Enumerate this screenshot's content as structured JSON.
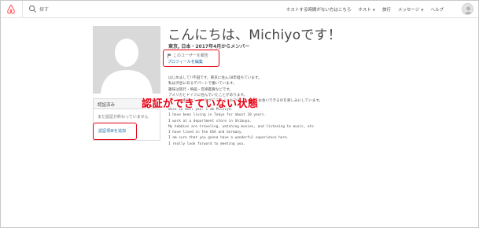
{
  "navbar": {
    "search_placeholder": "探す",
    "links": [
      {
        "label": "ホストする時間がない方はこちら",
        "caret": false
      },
      {
        "label": "ホスト",
        "caret": true
      },
      {
        "label": "旅行",
        "caret": false
      },
      {
        "label": "メッセージ",
        "caret": true
      },
      {
        "label": "ヘルプ",
        "caret": false
      }
    ]
  },
  "profile": {
    "greeting": "こんにちは、Michiyoです！",
    "member_line": "東京, 日本・2017年4月からメンバー",
    "report_link": "このユーザーを報告",
    "edit_link": "プロフィールを編集"
  },
  "verification": {
    "heading": "認証済み",
    "status_text": "まだ認証が終わっていません",
    "add_link": "認証項目を追加"
  },
  "bio": {
    "ja_lines": [
      "はじめまして!!不田です。東京に住ん18年経ちています。",
      "私は渋谷にあるデパートで働いています。",
      "趣味は旅行・映画・音楽鑑賞などです。",
      "アメリカとドイツに住んでいたことがあります。",
      "あなたが素晴らしい体験ができるようお手伝いします。お会いできるのを楽しみにしています。"
    ],
    "en_lines": [
      "Nice to meet you! I am Michiyo.",
      "I have been living in Tokyo for about 18 years.",
      "I work at a department store in Shibuya.",
      "My hobbies are traveling, watching movies, and listening to music, etc",
      "I have lived in the USA and Germany.",
      "I am sure that you gonna have a wonderful experience here.",
      "I really look forward to meeting you."
    ]
  },
  "annotation": {
    "text": "認証ができていない状態",
    "color": "#e60012"
  },
  "colors": {
    "brand": "#ff5a5f",
    "link": "#1a6fa4",
    "placeholder_photo": "#d9d9d9"
  }
}
